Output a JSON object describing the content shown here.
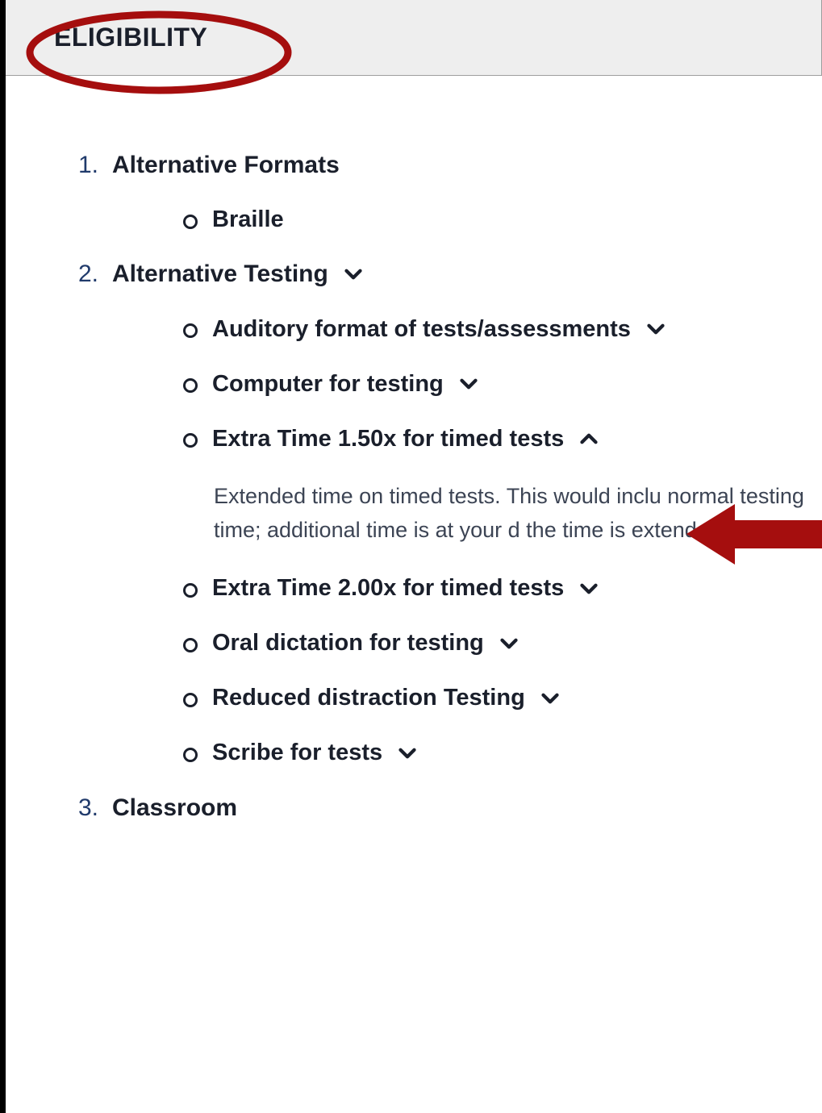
{
  "header": {
    "title": "ELIGIBILITY"
  },
  "sections": {
    "s1": {
      "num": "1.",
      "label": "Alternative Formats"
    },
    "s1_items": {
      "i0": "Braille"
    },
    "s2": {
      "num": "2.",
      "label": "Alternative Testing"
    },
    "s2_items": {
      "i0": "Auditory format of tests/assessments",
      "i1": "Computer for testing",
      "i2": "Extra Time 1.50x for timed tests",
      "i2_desc": "Extended time on timed tests. This would inclu normal testing time; additional time is at your d the time is extended.",
      "i3": "Extra Time 2.00x for timed tests",
      "i4": "Oral dictation for testing",
      "i5": "Reduced distraction Testing",
      "i6": "Scribe for tests"
    },
    "s3": {
      "num": "3.",
      "label": "Classroom"
    }
  },
  "colors": {
    "annotation": "#a50e0e",
    "num": "#203a6b"
  }
}
